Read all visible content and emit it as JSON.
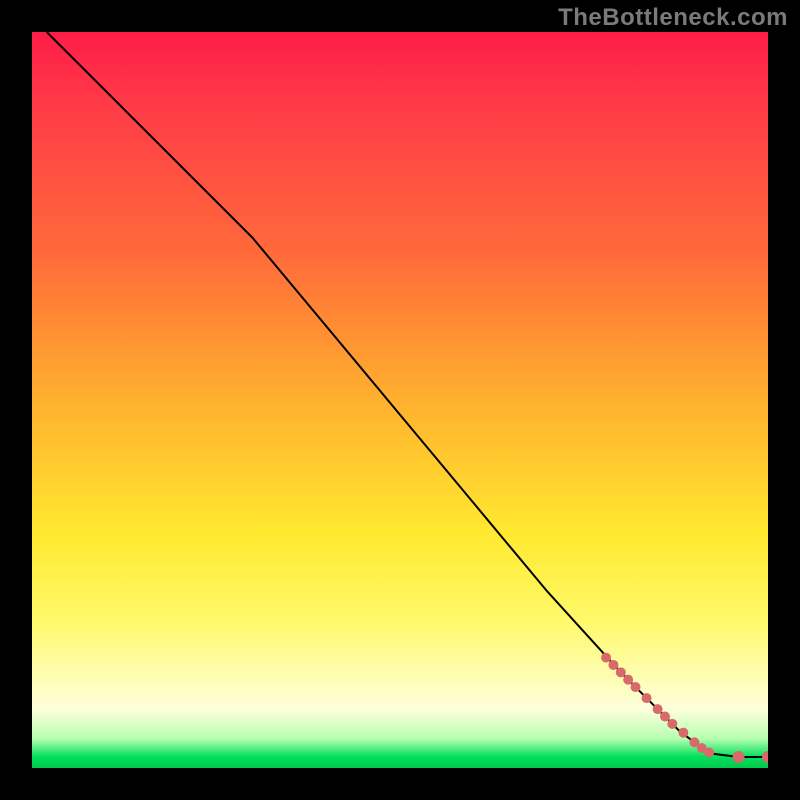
{
  "watermark": "TheBottleneck.com",
  "gradient": {
    "top": "#ff1c47",
    "mid1": "#ff6a3a",
    "mid2": "#ffe92f",
    "pale": "#fdffdc",
    "green": "#00e05a"
  },
  "chart_data": {
    "type": "line",
    "title": "",
    "xlabel": "",
    "ylabel": "",
    "xlim": [
      0,
      100
    ],
    "ylim": [
      0,
      100
    ],
    "series": [
      {
        "name": "curve",
        "color": "#000000",
        "points": [
          {
            "x": 2,
            "y": 100
          },
          {
            "x": 12,
            "y": 90
          },
          {
            "x": 22,
            "y": 80
          },
          {
            "x": 30,
            "y": 72
          },
          {
            "x": 40,
            "y": 60
          },
          {
            "x": 50,
            "y": 48
          },
          {
            "x": 60,
            "y": 36
          },
          {
            "x": 70,
            "y": 24
          },
          {
            "x": 80,
            "y": 13
          },
          {
            "x": 88,
            "y": 5
          },
          {
            "x": 92,
            "y": 2
          },
          {
            "x": 96,
            "y": 1.5
          },
          {
            "x": 100,
            "y": 1.5
          }
        ]
      }
    ],
    "markers": {
      "name": "highlighted-points",
      "color": "#d96a6a",
      "radius_small": 4,
      "radius_large": 6,
      "points": [
        {
          "x": 78,
          "y": 15,
          "r": 5
        },
        {
          "x": 79,
          "y": 14,
          "r": 5
        },
        {
          "x": 80,
          "y": 13,
          "r": 5
        },
        {
          "x": 81,
          "y": 12,
          "r": 5
        },
        {
          "x": 82,
          "y": 11,
          "r": 5
        },
        {
          "x": 83.5,
          "y": 9.5,
          "r": 5
        },
        {
          "x": 85,
          "y": 8,
          "r": 5
        },
        {
          "x": 86,
          "y": 7,
          "r": 5
        },
        {
          "x": 87,
          "y": 6,
          "r": 5
        },
        {
          "x": 88.5,
          "y": 4.8,
          "r": 5
        },
        {
          "x": 90,
          "y": 3.5,
          "r": 5
        },
        {
          "x": 91,
          "y": 2.7,
          "r": 5
        },
        {
          "x": 92,
          "y": 2.1,
          "r": 5
        },
        {
          "x": 96,
          "y": 1.5,
          "r": 6
        },
        {
          "x": 100,
          "y": 1.5,
          "r": 6
        }
      ]
    }
  }
}
